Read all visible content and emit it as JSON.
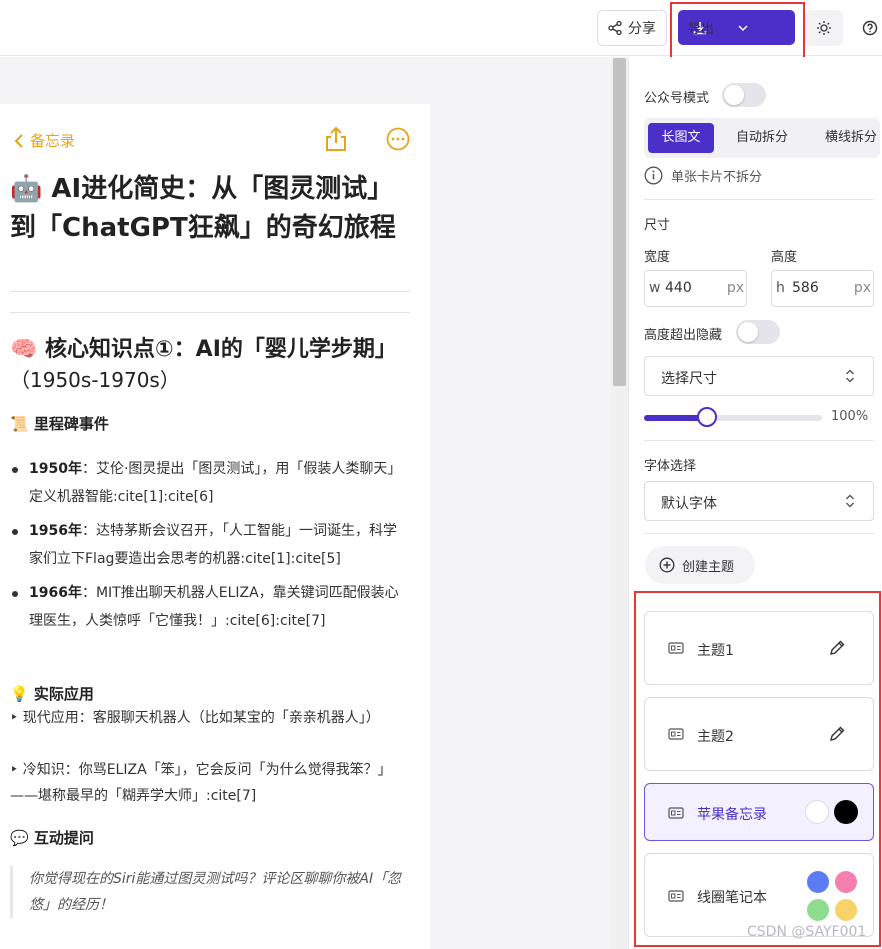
{
  "topbar": {
    "share_label": "分享",
    "export_label": "导出"
  },
  "card": {
    "back_label": "备忘录",
    "title": "🤖 AI进化简史：从「图灵测试」到「ChatGPT狂飙」的奇幻旅程",
    "section_title": "🧠 核心知识点①：AI的「婴儿学步期」",
    "section_period": "（1950s-1970s）",
    "milestones_heading": "📜 里程碑事件",
    "milestones": [
      {
        "year": "1950年",
        "text": "：艾伦·图灵提出「图灵测试」，用「假装人类聊天」定义机器智能:cite[1]:cite[6]"
      },
      {
        "year": "1956年",
        "text": "：达特茅斯会议召开，「人工智能」一词诞生，科学家们立下Flag要造出会思考的机器:cite[1]:cite[5]"
      },
      {
        "year": "1966年",
        "text": "：MIT推出聊天机器人ELIZA，靠关键词匹配假装心理医生，人类惊呼「它懂我！」:cite[6]:cite[7]"
      }
    ],
    "application_heading": "💡 实际应用",
    "application_text": "‣ 现代应用：客服聊天机器人（比如某宝的「亲亲机器人」）",
    "trivia_text": "‣ 冷知识：你骂ELIZA「笨」，它会反问「为什么觉得我笨？」——堪称最早的「糊弄学大师」:cite[7]",
    "interaction_heading": "💬 互动提问",
    "quote": "你觉得现在的Siri能通过图灵测试吗？评论区聊聊你被AI「忽悠」的经历！"
  },
  "panel": {
    "wechat_mode_label": "公众号模式",
    "wechat_mode_on": false,
    "split_tabs": [
      "长图文",
      "自动拆分",
      "横线拆分"
    ],
    "split_active": "长图文",
    "hint": "单张卡片不拆分",
    "size_heading": "尺寸",
    "width_label": "宽度",
    "height_label": "高度",
    "width_prefix": "w",
    "height_prefix": "h",
    "width_value": "440",
    "height_value": "586",
    "unit": "px",
    "overflow_hide_label": "高度超出隐藏",
    "overflow_hide_on": false,
    "size_select": "选择尺寸",
    "scale_percent": 100,
    "scale_label": "100%",
    "font_heading": "字体选择",
    "font_select": "默认字体",
    "create_theme_label": "创建主题",
    "themes": [
      {
        "name": "主题1"
      },
      {
        "name": "主题2"
      },
      {
        "name": "苹果备忘录",
        "selected": true,
        "swatches": [
          "#ffffff",
          "#000000"
        ]
      },
      {
        "name": "线圈笔记本",
        "swatches": [
          "#5b7cf5",
          "#f67fb0",
          "#8fdc8c",
          "#f8d36a"
        ]
      }
    ]
  },
  "watermark": "CSDN @SAYF001",
  "colors": {
    "accent": "#4a2fc9",
    "memo_yellow": "#e6a417",
    "highlight_red": "#e53935"
  }
}
